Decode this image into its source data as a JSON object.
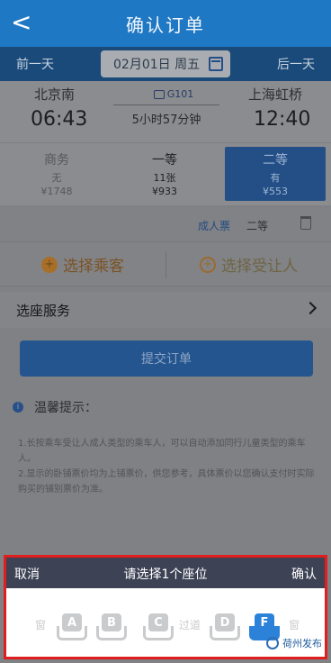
{
  "header": {
    "back_glyph": "<",
    "title": "确认订单"
  },
  "date_bar": {
    "prev_day": "前一天",
    "date": "02月01日 周五",
    "next_day": "后一天",
    "calendar_icon": "calendar-icon"
  },
  "train": {
    "from_station": "北京南",
    "depart_time": "06:43",
    "number": "G101",
    "duration": "5小时57分钟",
    "to_station": "上海虹桥",
    "arrive_time": "12:40"
  },
  "seat_classes": [
    {
      "name": "商务",
      "count": "无",
      "price": "¥1748"
    },
    {
      "name": "一等",
      "count": "11张",
      "price": "¥933"
    },
    {
      "name": "二等",
      "count": "有",
      "price": "¥553"
    }
  ],
  "ticket": {
    "type": "成人票",
    "class": "二等"
  },
  "pick": {
    "passenger": "选择乘客",
    "beneficiary": "选择受让人"
  },
  "service": {
    "label": "选座服务"
  },
  "submit_label": "提交订单",
  "tips": {
    "title": "温馨提示：",
    "items": [
      "1.长按乘车受让人成人类型的乘车人，可以自动添加同行儿童类型的乘车人。",
      "2.显示的卧铺票价均为上铺票价，供您参考，具体票价以您确认支付时实际购买的铺别票价为准。"
    ]
  },
  "seat_picker": {
    "cancel": "取消",
    "title": "请选择1个座位",
    "confirm": "确认",
    "window_left": "窗",
    "aisle": "过道",
    "window_right": "窗",
    "seats": [
      "A",
      "B",
      "C",
      "D",
      "F"
    ],
    "selected": "F"
  },
  "watermark": "荷州发布",
  "colors": {
    "header": "#1f78c4",
    "highlight_border": "#e01e1e",
    "selected_seat": "#2c82d9"
  }
}
